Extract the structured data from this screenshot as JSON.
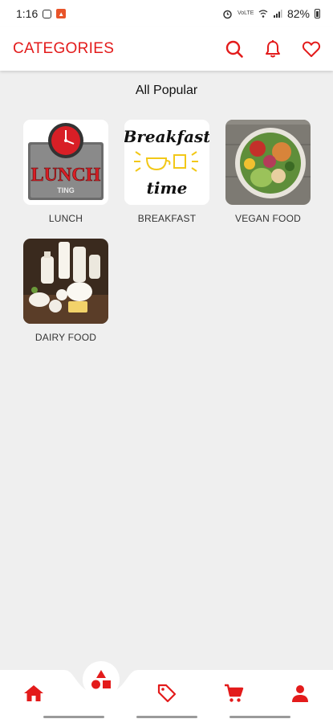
{
  "status_bar": {
    "time": "1:16",
    "battery": "82%",
    "network_label": "VoLTE"
  },
  "app_bar": {
    "title": "CATEGORIES",
    "icons": [
      "search-icon",
      "bell-icon",
      "heart-icon"
    ]
  },
  "colors": {
    "accent": "#e31b1b",
    "background": "#efefef",
    "surface": "#ffffff"
  },
  "section": {
    "title": "All Popular"
  },
  "categories": [
    {
      "label": "LUNCH",
      "image": "lunch-ting-sign-image",
      "image_text_1": "LUNCH",
      "image_text_2": "TING"
    },
    {
      "label": "BREAKFAST",
      "image": "breakfast-time-lettering-image",
      "image_text_1": "Breakfast",
      "image_text_2": "time"
    },
    {
      "label": "VEGAN FOOD",
      "image": "vegan-bowl-image"
    },
    {
      "label": "DAIRY FOOD",
      "image": "dairy-products-image"
    }
  ],
  "bottom_nav": {
    "items": [
      "home-icon",
      "categories-shapes-icon",
      "tag-icon",
      "cart-icon",
      "profile-icon"
    ],
    "active": "categories-shapes-icon"
  }
}
